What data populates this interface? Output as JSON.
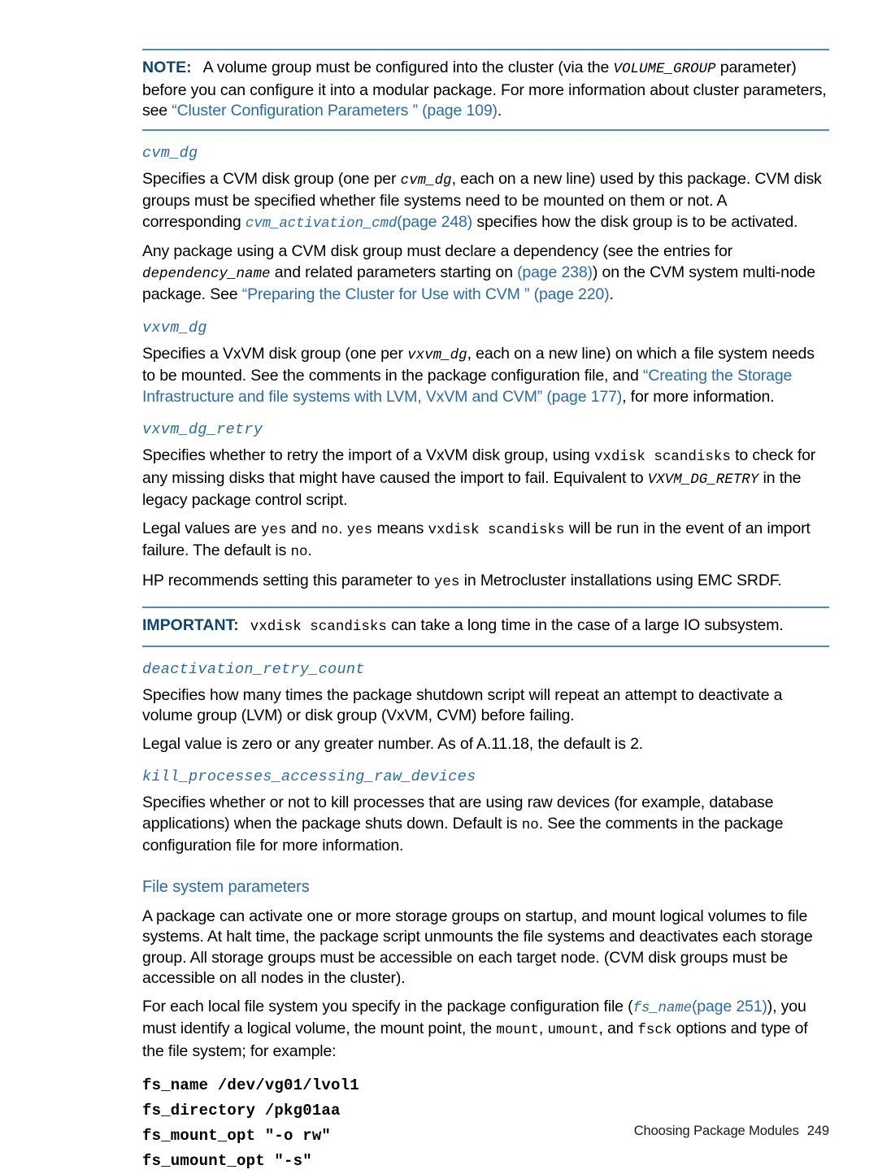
{
  "page": {
    "footer_text": "Choosing Package Modules",
    "footer_page_number": "249"
  },
  "colors": {
    "link": "#2b6ca3",
    "admonition_label": "#10456e",
    "rule": "#4b8fad",
    "text": "#000000"
  },
  "note": {
    "label": "NOTE:",
    "part1": "A volume group must be configured into the cluster (via the ",
    "code1": "VOLUME_GROUP",
    "part2": " parameter) before you can configure it into a modular package. For more information about cluster parameters, see ",
    "link1": "“Cluster Configuration Parameters ” (page 109)",
    "part3": "."
  },
  "cvm_dg": {
    "heading": "cvm_dg",
    "p1_a": "Specifies a CVM disk group (one per ",
    "p1_code": "cvm_dg",
    "p1_b": ", each on a new line) used by this package. CVM disk groups must be specified whether file systems need to be mounted on them or not. A corresponding ",
    "p1_link_code": "cvm_activation_cmd",
    "p1_link_page": "(page 248)",
    "p1_c": " specifies how the disk group is to be activated.",
    "p2_a": "Any package using a CVM disk group must declare a dependency (see the entries for ",
    "p2_code": "dependency_name",
    "p2_b": " and related parameters starting on ",
    "p2_link1": "(page 238)",
    "p2_c": ") on the CVM system multi-node package. See ",
    "p2_link2": "“Preparing the Cluster for Use with CVM ” (page 220)",
    "p2_d": "."
  },
  "vxvm_dg": {
    "heading": "vxvm_dg",
    "p1_a": "Specifies a VxVM disk group (one per ",
    "p1_code": "vxvm_dg",
    "p1_b": ", each on a new line) on which a file system needs to be mounted. See the comments in the package configuration file, and ",
    "p1_link": "“Creating the Storage Infrastructure and file systems with LVM, VxVM and CVM” (page 177)",
    "p1_c": ", for more information."
  },
  "vxvm_dg_retry": {
    "heading": "vxvm_dg_retry",
    "p1_a": "Specifies whether to retry the import of a VxVM disk group, using ",
    "p1_code1": "vxdisk scandisks",
    "p1_b": " to check for any missing disks that might have caused the import to fail. Equivalent to ",
    "p1_code2": "VXVM_DG_RETRY",
    "p1_c": " in the legacy package control script.",
    "p2_a": "Legal values are ",
    "p2_code1": "yes",
    "p2_b": " and ",
    "p2_code2": "no",
    "p2_c": ". ",
    "p2_code3": "yes",
    "p2_d": " means ",
    "p2_code4": "vxdisk scandisks",
    "p2_e": " will be run in the event of an import failure. The default is ",
    "p2_code5": "no",
    "p2_f": ".",
    "p3_a": "HP recommends setting this parameter to ",
    "p3_code": "yes",
    "p3_b": " in Metrocluster installations using EMC SRDF."
  },
  "important": {
    "label": "IMPORTANT:",
    "code": "vxdisk scandisks",
    "text": " can take a long time in the case of a large IO subsystem."
  },
  "deactivation_retry_count": {
    "heading": "deactivation_retry_count",
    "p1": "Specifies how many times the package shutdown script will repeat an attempt to deactivate a volume group (LVM) or disk group (VxVM, CVM) before failing.",
    "p2": "Legal value is zero or any greater number. As of A.11.18, the default is 2."
  },
  "kill_processes": {
    "heading": "kill_processes_accessing_raw_devices",
    "p1_a": "Specifies whether or not to kill processes that are using raw devices (for example, database applications) when the package shuts down. Default is ",
    "p1_code": "no",
    "p1_b": ". See the comments in the package configuration file for more information."
  },
  "file_system_parameters": {
    "heading": "File system parameters",
    "p1": "A package can activate one or more storage groups on startup, and mount logical volumes to file systems. At halt time, the package script unmounts the file systems and deactivates each storage group. All storage groups must be accessible on each target node. (CVM disk groups must be accessible on all nodes in the cluster).",
    "p2_a": "For each local file system you specify in the package configuration file (",
    "p2_code": "fs_name",
    "p2_link": "(page 251)",
    "p2_b": "), you must identify a logical volume, the mount point, the ",
    "p2_code2": "mount",
    "p2_c": ", ",
    "p2_code3": "umount",
    "p2_d": ", and ",
    "p2_code4": "fsck",
    "p2_e": " options and type of the file system; for example:",
    "code_lines": [
      "fs_name /dev/vg01/lvol1",
      "fs_directory /pkg01aa",
      "fs_mount_opt \"-o rw\"",
      "fs_umount_opt \"-s\""
    ]
  }
}
